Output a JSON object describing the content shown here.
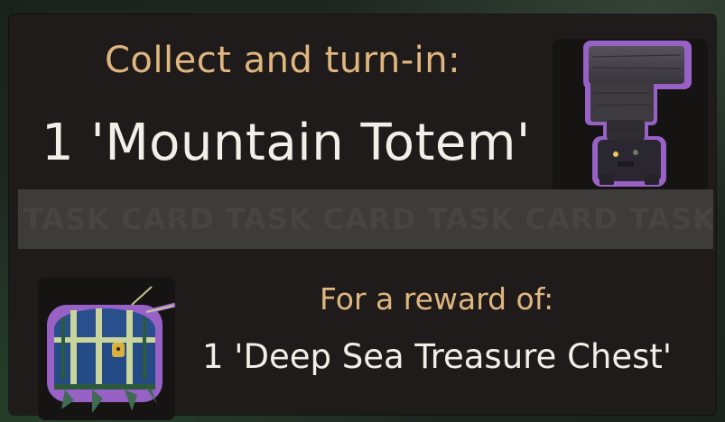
{
  "task": {
    "title": "Collect and turn-in:",
    "item": "1 'Mountain Totem'",
    "item_icon": "mountain-totem-icon"
  },
  "divider": {
    "watermark": "TASK CARD TASK CARD TASK CARD TASK CARD"
  },
  "reward": {
    "title": "For a reward of:",
    "item": "1 'Deep Sea Treasure Chest'",
    "item_icon": "treasure-chest-icon"
  },
  "colors": {
    "title": "#e0b67f",
    "text": "#f3efe8",
    "card": "#1f1b1b",
    "divider": "#3e3b3b",
    "item_glow": "#a56ad9"
  }
}
